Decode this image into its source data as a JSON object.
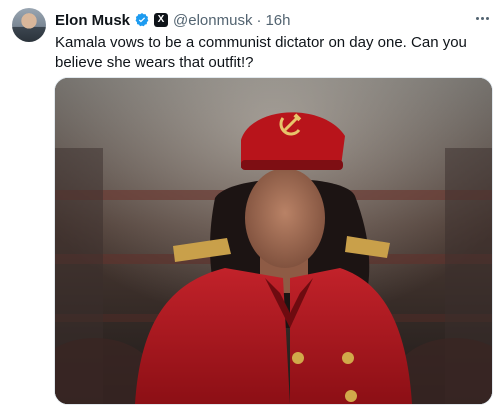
{
  "post": {
    "author_name": "Elon Musk",
    "handle": "@elonmusk",
    "separator": "·",
    "time": "16h",
    "text": "Kamala vows to be a communist dictator on day one. Can you believe she wears that outfit!?",
    "icons": {
      "avatar": "profile-photo",
      "verified": "verified-badge-icon",
      "affiliation": "x-logo-icon",
      "more": "more-horizontal-icon",
      "cap_emblem": "hammer-and-sickle-icon"
    }
  },
  "colors": {
    "text_primary": "#0f1419",
    "text_secondary": "#536471",
    "verified": "#1d9bf0",
    "jacket_red": "#b3141c",
    "gold": "#d1a94a"
  }
}
